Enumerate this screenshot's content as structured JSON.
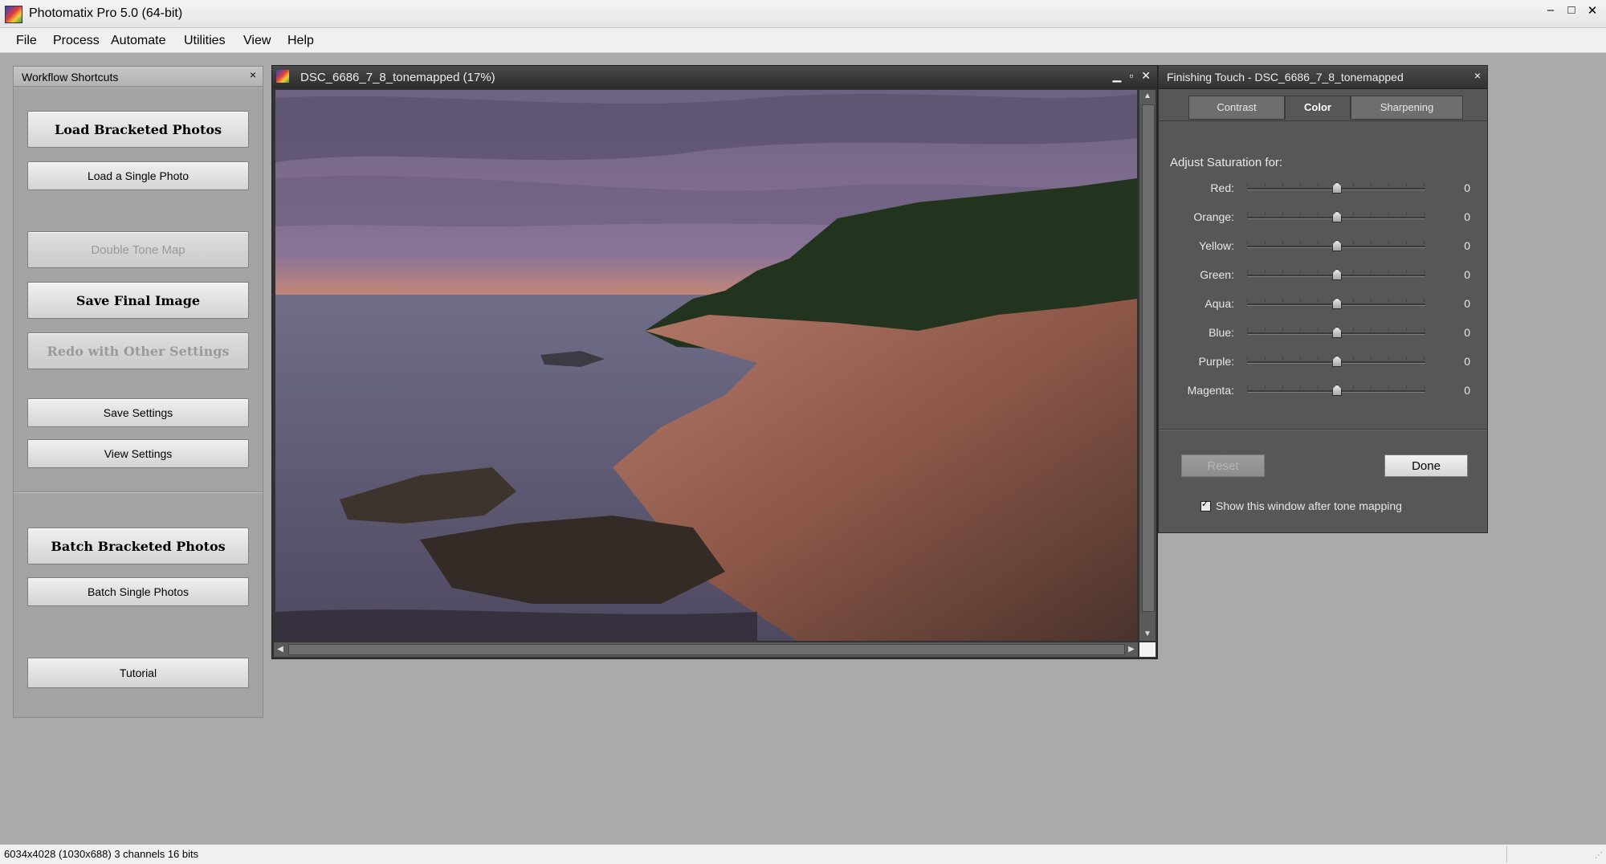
{
  "app": {
    "title": "Photomatix Pro 5.0 (64-bit)",
    "window_controls": [
      "–",
      "□",
      "✕"
    ]
  },
  "menu": [
    "File",
    "Process",
    "Automate",
    "Utilities",
    "View",
    "Help"
  ],
  "workflow": {
    "title": "Workflow Shortcuts",
    "close": "×",
    "buttons": {
      "load_bracketed": "Load Bracketed Photos",
      "load_single": "Load a Single Photo",
      "double_tone_map": "Double Tone Map",
      "save_final": "Save Final Image",
      "redo_other": "Redo with Other Settings",
      "save_settings": "Save Settings",
      "view_settings": "View Settings",
      "batch_bracketed": "Batch Bracketed Photos",
      "batch_single": "Batch Single Photos",
      "tutorial": "Tutorial"
    }
  },
  "image_window": {
    "title": "DSC_6686_7_8_tonemapped (17%)",
    "controls": [
      "▁",
      "▫",
      "✕"
    ]
  },
  "finishing": {
    "title": "Finishing Touch - DSC_6686_7_8_tonemapped",
    "close": "×",
    "tabs": [
      "Contrast",
      "Color",
      "Sharpening"
    ],
    "active_tab": "Color",
    "section_label": "Adjust Saturation for:",
    "sliders": [
      {
        "label": "Red:",
        "value": "0"
      },
      {
        "label": "Orange:",
        "value": "0"
      },
      {
        "label": "Yellow:",
        "value": "0"
      },
      {
        "label": "Green:",
        "value": "0"
      },
      {
        "label": "Aqua:",
        "value": "0"
      },
      {
        "label": "Blue:",
        "value": "0"
      },
      {
        "label": "Purple:",
        "value": "0"
      },
      {
        "label": "Magenta:",
        "value": "0"
      }
    ],
    "reset_label": "Reset",
    "done_label": "Done",
    "checkbox_label": "Show this window after tone mapping",
    "checkbox_checked": true
  },
  "status": {
    "text": "6034x4028 (1030x688) 3 channels 16 bits"
  }
}
